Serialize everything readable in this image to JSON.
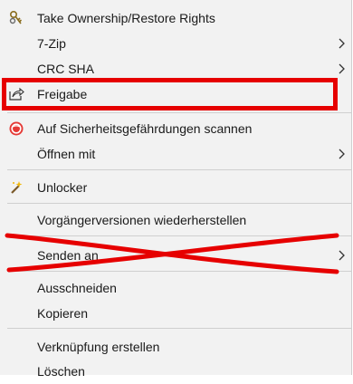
{
  "menu": {
    "items": [
      {
        "label": "Take Ownership/Restore Rights",
        "icon": "keys-icon",
        "submenu": false
      },
      {
        "label": "7-Zip",
        "submenu": true
      },
      {
        "label": "CRC SHA",
        "submenu": true
      },
      {
        "label": "Freigabe",
        "icon": "share-icon",
        "submenu": false
      },
      {
        "label": "Auf Sicherheitsgefährdungen scannen",
        "icon": "security-scan-icon",
        "submenu": false
      },
      {
        "label": "Öffnen mit",
        "submenu": true
      },
      {
        "label": "Unlocker",
        "icon": "magic-wand-icon",
        "submenu": false
      },
      {
        "label": "Vorgängerversionen wiederherstellen",
        "submenu": false
      },
      {
        "label": "Senden an",
        "submenu": true
      },
      {
        "label": "Ausschneiden",
        "submenu": false
      },
      {
        "label": "Kopieren",
        "submenu": false
      },
      {
        "label": "Verknüpfung erstellen",
        "submenu": false
      },
      {
        "label": "Löschen",
        "submenu": false
      }
    ]
  },
  "annotations": {
    "highlight_color": "#e60000",
    "highlighted_item": "Freigabe",
    "crossed_out_item": "Senden an"
  }
}
